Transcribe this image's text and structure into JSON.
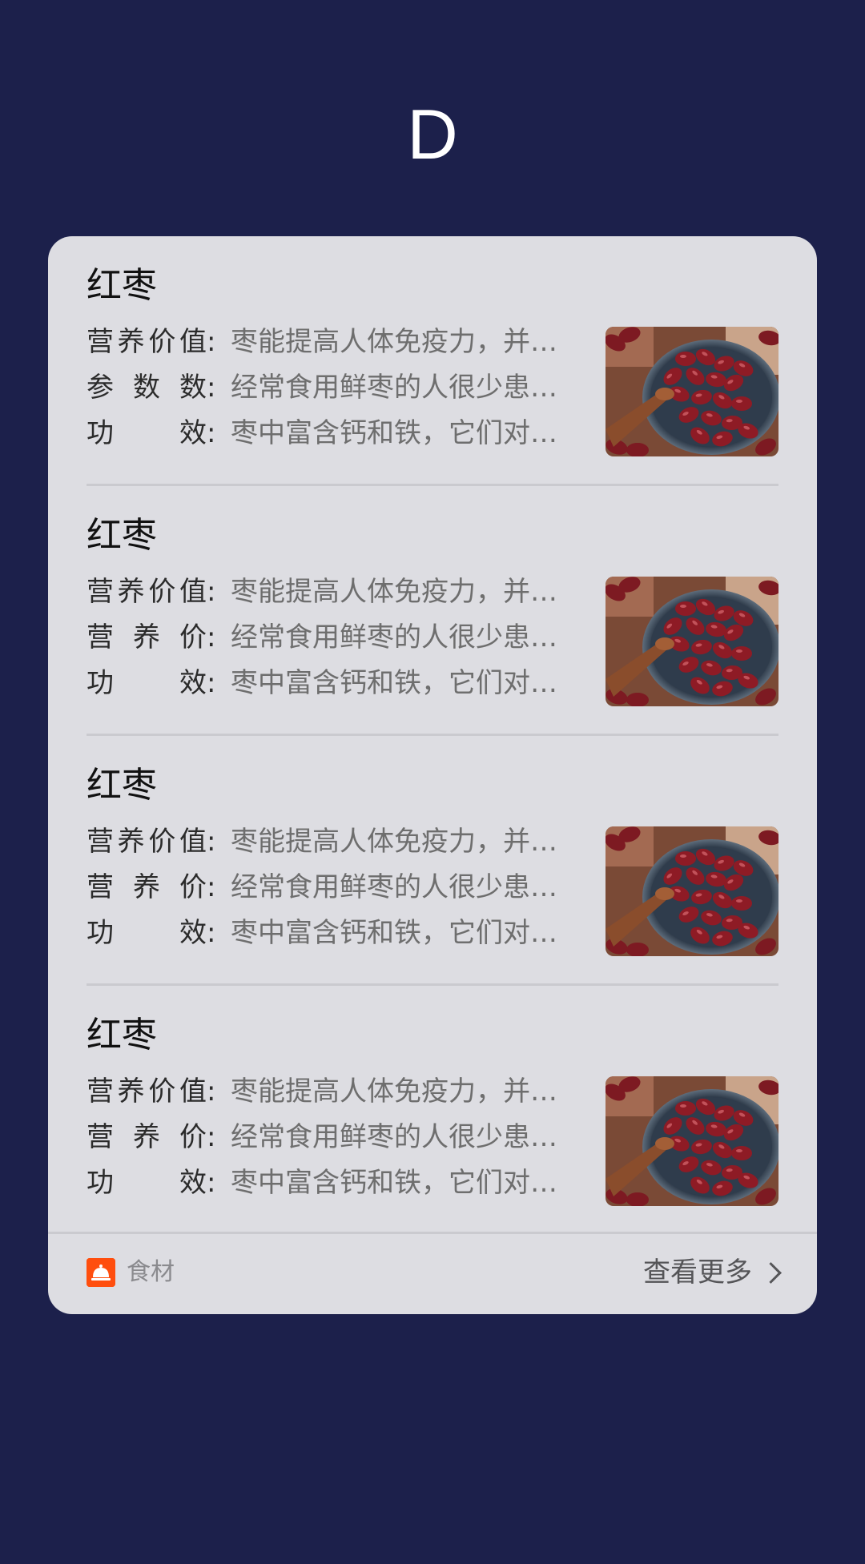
{
  "header": {
    "letter": "D"
  },
  "card": {
    "items": [
      {
        "title": "红枣",
        "rows": [
          {
            "label": "营养价值",
            "value": "枣能提高人体免疫力，并可抑制癌细胞"
          },
          {
            "label": "参数数",
            "value": "经常食用鲜枣的人很少患胆结石"
          },
          {
            "label": "功效",
            "value": "枣中富含钙和铁，它们对防治骨质疏松"
          }
        ],
        "image": "red-dates-bowl"
      },
      {
        "title": "红枣",
        "rows": [
          {
            "label": "营养价值",
            "value": "枣能提高人体免疫力，并可抑制癌细胞"
          },
          {
            "label": "营养价",
            "value": "经常食用鲜枣的人很少患胆结石"
          },
          {
            "label": "功效",
            "value": "枣中富含钙和铁，它们对防治骨质疏松"
          }
        ],
        "image": "red-dates-bowl"
      },
      {
        "title": "红枣",
        "rows": [
          {
            "label": "营养价值",
            "value": "枣能提高人体免疫力，并可抑制癌细胞"
          },
          {
            "label": "营养价",
            "value": "经常食用鲜枣的人很少患胆结石"
          },
          {
            "label": "功效",
            "value": "枣中富含钙和铁，它们对防治骨质疏松"
          }
        ],
        "image": "red-dates-bowl"
      },
      {
        "title": "红枣",
        "rows": [
          {
            "label": "营养价值",
            "value": "枣能提高人体免疫力，并可抑制癌细胞"
          },
          {
            "label": "营养价",
            "value": "经常食用鲜枣的人很少患胆结石"
          },
          {
            "label": "功效",
            "value": "枣中富含钙和铁，它们对防治骨质疏松"
          }
        ],
        "image": "red-dates-bowl"
      }
    ],
    "footer": {
      "icon": "food-cloche-icon",
      "label": "食材",
      "more_label": "查看更多",
      "more_icon": "chevron-right-icon"
    }
  },
  "colors": {
    "background": "#1c204b",
    "card": "#dddde2",
    "accent": "#ff4e0e"
  }
}
